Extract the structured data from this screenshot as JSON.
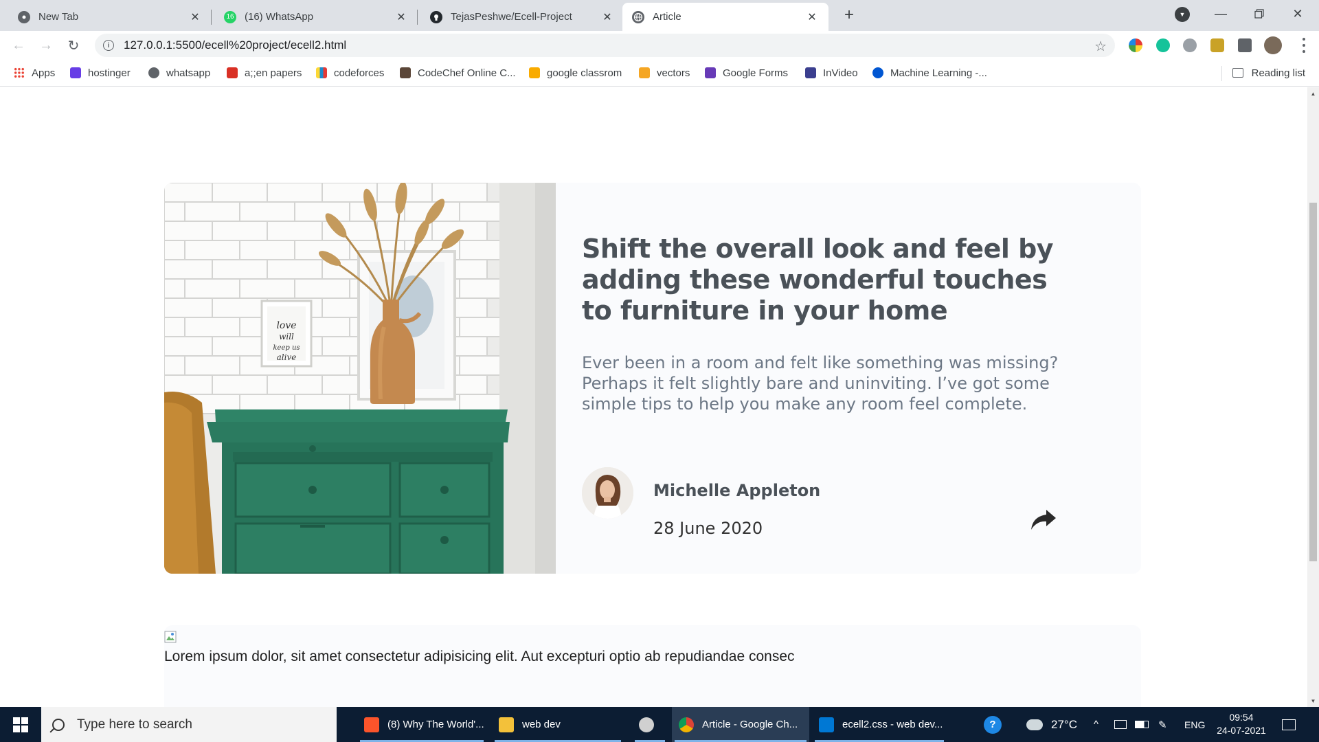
{
  "browser": {
    "tabs": [
      {
        "title": "New Tab",
        "icon": "chrome-icon",
        "active": false
      },
      {
        "title": "(16) WhatsApp",
        "icon": "whatsapp-icon",
        "badge": "16",
        "active": false
      },
      {
        "title": "TejasPeshwe/Ecell-Project",
        "icon": "github-icon",
        "active": false
      },
      {
        "title": "Article",
        "icon": "globe-icon",
        "active": true
      }
    ],
    "url": "127.0.0.1:5500/ecell%20project/ecell2.html",
    "bookmarks": [
      {
        "label": "Apps",
        "icon": "apps-grid-icon",
        "color": "#4285f4"
      },
      {
        "label": "hostinger",
        "icon": "hostinger-icon",
        "color": "#673de6"
      },
      {
        "label": "whatsapp",
        "icon": "whatsapp-icon",
        "color": "#5f6368"
      },
      {
        "label": "a;;en papers",
        "icon": "papers-icon",
        "color": "#d93025"
      },
      {
        "label": "codeforces",
        "icon": "codeforces-icon",
        "color": "#1f8acb"
      },
      {
        "label": "CodeChef Online C...",
        "icon": "codechef-icon",
        "color": "#5b4638"
      },
      {
        "label": "google classrom",
        "icon": "classroom-icon",
        "color": "#f9ab00"
      },
      {
        "label": "vectors",
        "icon": "vectors-icon",
        "color": "#f5a623"
      },
      {
        "label": "Google Forms",
        "icon": "forms-icon",
        "color": "#673ab7"
      },
      {
        "label": "InVideo",
        "icon": "invideo-icon",
        "color": "#3b3f8f"
      },
      {
        "label": "Machine Learning -...",
        "icon": "coursera-icon",
        "color": "#0056d2"
      }
    ],
    "reading_list": "Reading list"
  },
  "article": {
    "headline": "Shift the overall look and feel by adding these wonderful touches to furniture in your home",
    "excerpt": "Ever been in a room and felt like something was missing? Perhaps it felt slightly bare and uninviting. I’ve got some simple tips to help you make any room feel complete.",
    "author": "Michelle Appleton",
    "date": "28 June 2020",
    "frame_text": "love will keep us alive"
  },
  "second_card": {
    "text": "Lorem ipsum dolor, sit amet consectetur adipisicing elit. Aut excepturi optio ab repudiandae consec"
  },
  "taskbar": {
    "search_placeholder": "Type here to search",
    "apps": [
      {
        "label": "(8) Why The World'...",
        "icon": "brave-icon",
        "color": "#fb542b"
      },
      {
        "label": "web dev",
        "icon": "folder-icon",
        "color": "#f3c13a"
      },
      {
        "label": "",
        "icon": "paint-icon",
        "color": "#d0d0d0"
      },
      {
        "label": "Article - Google Ch...",
        "icon": "chrome-icon",
        "color": "#db4437"
      },
      {
        "label": "ecell2.css - web dev...",
        "icon": "vscode-icon",
        "color": "#0078d4"
      }
    ],
    "temperature": "27°C",
    "language": "ENG",
    "time": "09:54",
    "date": "24-07-2021"
  },
  "colors": {
    "headline": "#4a5158",
    "excerpt": "#6c7785",
    "card_bg": "#fafbfd",
    "dresser_green": "#2e7d64"
  }
}
